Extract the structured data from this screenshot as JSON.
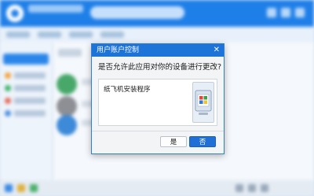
{
  "dialog": {
    "title": "用户账户控制",
    "close_glyph": "✕",
    "question": "是否允许此应用对你的设备进行更改?",
    "program_name": "纸飞机安装程序",
    "yes_label": "是",
    "no_label": "否"
  },
  "icons": {
    "dialog_icon": "shield-program-icon",
    "close": "close-icon"
  },
  "colors": {
    "title_bar": "#1c73d8",
    "primary_button": "#1f6fd6",
    "background_app_accent": "#1f7fe8"
  }
}
